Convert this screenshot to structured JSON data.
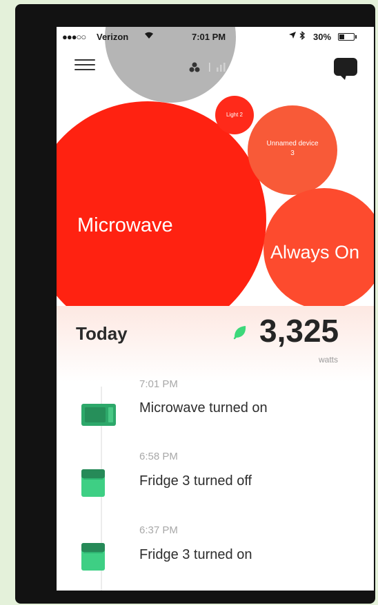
{
  "status_bar": {
    "signal": "●●●○○",
    "carrier": "Verizon",
    "wifi_icon": "wifi-icon",
    "time": "7:01 PM",
    "location_icon": "location-arrow-icon",
    "bluetooth_icon": "bluetooth-icon",
    "battery_percent": "30%"
  },
  "header": {
    "menu_icon": "hamburger-menu-icon",
    "view_toggle": [
      "bubble-view-icon",
      "bar-chart-icon"
    ],
    "chat_icon": "chat-bubble-icon"
  },
  "bubbles": [
    {
      "label": "",
      "color": "#b5b5b5"
    },
    {
      "label": "Microwave",
      "color": "#ff2211"
    },
    {
      "label": "Light 2",
      "color": "#ff2a1a"
    },
    {
      "label": "Unnamed device 3",
      "color": "#f85a38"
    },
    {
      "label": "Always On",
      "color": "#fd4b2e"
    }
  ],
  "summary": {
    "period": "Today",
    "power_icon": "plug-icon",
    "value": "3,325",
    "unit": "watts",
    "accent_color": "#3dd87a"
  },
  "events": [
    {
      "time": "7:01 PM",
      "text": "Microwave turned on",
      "icon": "microwave-icon"
    },
    {
      "time": "6:58 PM",
      "text": "Fridge 3 turned off",
      "icon": "fridge-icon"
    },
    {
      "time": "6:37 PM",
      "text": "Fridge 3 turned on",
      "icon": "fridge-icon"
    }
  ]
}
